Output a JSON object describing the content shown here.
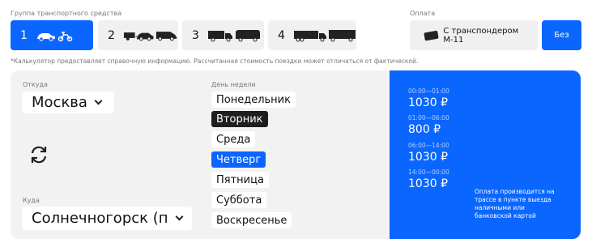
{
  "vehicle_group": {
    "label": "Группа транспортного средства",
    "options": [
      {
        "num": "1",
        "active": true
      },
      {
        "num": "2",
        "active": false
      },
      {
        "num": "3",
        "active": false
      },
      {
        "num": "4",
        "active": false
      }
    ]
  },
  "payment": {
    "label": "Оплата",
    "transponder": "С транспондером М-11",
    "no_transponder": "Без"
  },
  "disclaimer": "*Калькулятор предоставляет справочную информацию. Рассчитанная стоимость поездки может отличаться от фактической.",
  "route": {
    "from_label": "Откуда",
    "from_value": "Москва",
    "to_label": "Куда",
    "to_value": "Солнечногорск (п"
  },
  "weekday": {
    "label": "День недели",
    "days": [
      {
        "name": "Понедельник",
        "state": "default"
      },
      {
        "name": "Вторник",
        "state": "selected-dark"
      },
      {
        "name": "Среда",
        "state": "default"
      },
      {
        "name": "Четверг",
        "state": "highlight"
      },
      {
        "name": "Пятница",
        "state": "default"
      },
      {
        "name": "Суббота",
        "state": "default"
      },
      {
        "name": "Воскресенье",
        "state": "default"
      }
    ]
  },
  "tariffs": [
    {
      "time": "00:00—01:00",
      "price": "1030 ₽"
    },
    {
      "time": "01:00—06:00",
      "price": "800 ₽"
    },
    {
      "time": "06:00—14:00",
      "price": "1030 ₽"
    },
    {
      "time": "14:00—00:00",
      "price": "1030 ₽"
    }
  ],
  "payment_note": "Оплата производится на трассе в пункте выезда наличными или банковской картой",
  "colors": {
    "accent": "#0a66ff",
    "dark": "#1e1e1e",
    "panel": "#f2f2f2"
  }
}
